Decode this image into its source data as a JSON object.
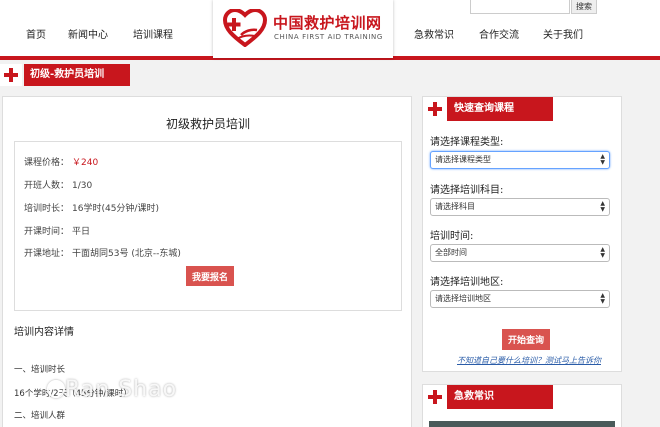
{
  "header": {
    "nav_left": [
      "首页",
      "新闻中心",
      "培训课程"
    ],
    "nav_right": [
      "急救常识",
      "合作交流",
      "关于我们"
    ],
    "logo_cn": "中国救护培训网",
    "logo_en": "CHINA FIRST AID TRAINING",
    "search_button": "搜索",
    "search_placeholder": ""
  },
  "band_title": "初级-救护员培训",
  "main": {
    "title": "初级救护员培训",
    "info": [
      {
        "label": "课程价格：",
        "value": "￥240"
      },
      {
        "label": "开班人数：",
        "value": "1/30"
      },
      {
        "label": "培训时长：",
        "value": "16学时(45分钟/课时)"
      },
      {
        "label": "开课时间：",
        "value": "平日"
      },
      {
        "label": "开课地址：",
        "value": "干面胡同53号 (北京--东城)"
      }
    ],
    "apply_button": "我要报名",
    "detail_title": "培训内容详情",
    "detail_lines": [
      "一、培训时长",
      "16个学时/2天（45分钟/课时）",
      "二、培训人群"
    ],
    "watermark": "Ran Shao"
  },
  "sidebar": {
    "title": "快速查询课程",
    "fields": [
      {
        "label": "请选择课程类型:",
        "value": "请选择课程类型"
      },
      {
        "label": "请选择培训科目:",
        "value": "请选择科目"
      },
      {
        "label": "培训时间:",
        "value": "全部时间"
      },
      {
        "label": "请选择培训地区:",
        "value": "请选择培训地区"
      }
    ],
    "query_button": "开始查询",
    "link": "不知道自己要什么培训？测试马上告诉你"
  },
  "sidebar2": {
    "title": "急救常识"
  },
  "colors": {
    "brand_red": "#c8161d",
    "button_red": "#d9534f",
    "link_blue": "#2a5ca8"
  }
}
